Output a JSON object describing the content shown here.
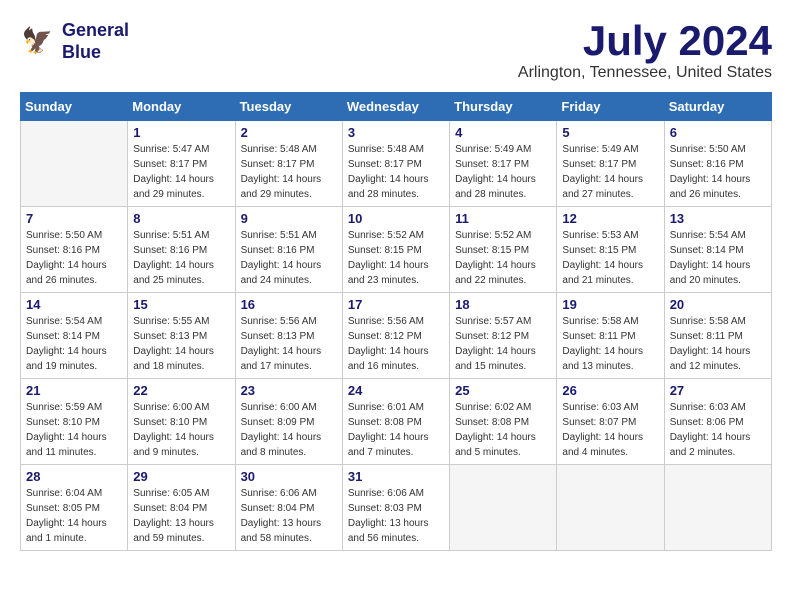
{
  "header": {
    "logo_line1": "General",
    "logo_line2": "Blue",
    "month": "July 2024",
    "location": "Arlington, Tennessee, United States"
  },
  "days_of_week": [
    "Sunday",
    "Monday",
    "Tuesday",
    "Wednesday",
    "Thursday",
    "Friday",
    "Saturday"
  ],
  "weeks": [
    [
      {
        "day": "",
        "info": ""
      },
      {
        "day": "1",
        "info": "Sunrise: 5:47 AM\nSunset: 8:17 PM\nDaylight: 14 hours\nand 29 minutes."
      },
      {
        "day": "2",
        "info": "Sunrise: 5:48 AM\nSunset: 8:17 PM\nDaylight: 14 hours\nand 29 minutes."
      },
      {
        "day": "3",
        "info": "Sunrise: 5:48 AM\nSunset: 8:17 PM\nDaylight: 14 hours\nand 28 minutes."
      },
      {
        "day": "4",
        "info": "Sunrise: 5:49 AM\nSunset: 8:17 PM\nDaylight: 14 hours\nand 28 minutes."
      },
      {
        "day": "5",
        "info": "Sunrise: 5:49 AM\nSunset: 8:17 PM\nDaylight: 14 hours\nand 27 minutes."
      },
      {
        "day": "6",
        "info": "Sunrise: 5:50 AM\nSunset: 8:16 PM\nDaylight: 14 hours\nand 26 minutes."
      }
    ],
    [
      {
        "day": "7",
        "info": "Sunrise: 5:50 AM\nSunset: 8:16 PM\nDaylight: 14 hours\nand 26 minutes."
      },
      {
        "day": "8",
        "info": "Sunrise: 5:51 AM\nSunset: 8:16 PM\nDaylight: 14 hours\nand 25 minutes."
      },
      {
        "day": "9",
        "info": "Sunrise: 5:51 AM\nSunset: 8:16 PM\nDaylight: 14 hours\nand 24 minutes."
      },
      {
        "day": "10",
        "info": "Sunrise: 5:52 AM\nSunset: 8:15 PM\nDaylight: 14 hours\nand 23 minutes."
      },
      {
        "day": "11",
        "info": "Sunrise: 5:52 AM\nSunset: 8:15 PM\nDaylight: 14 hours\nand 22 minutes."
      },
      {
        "day": "12",
        "info": "Sunrise: 5:53 AM\nSunset: 8:15 PM\nDaylight: 14 hours\nand 21 minutes."
      },
      {
        "day": "13",
        "info": "Sunrise: 5:54 AM\nSunset: 8:14 PM\nDaylight: 14 hours\nand 20 minutes."
      }
    ],
    [
      {
        "day": "14",
        "info": "Sunrise: 5:54 AM\nSunset: 8:14 PM\nDaylight: 14 hours\nand 19 minutes."
      },
      {
        "day": "15",
        "info": "Sunrise: 5:55 AM\nSunset: 8:13 PM\nDaylight: 14 hours\nand 18 minutes."
      },
      {
        "day": "16",
        "info": "Sunrise: 5:56 AM\nSunset: 8:13 PM\nDaylight: 14 hours\nand 17 minutes."
      },
      {
        "day": "17",
        "info": "Sunrise: 5:56 AM\nSunset: 8:12 PM\nDaylight: 14 hours\nand 16 minutes."
      },
      {
        "day": "18",
        "info": "Sunrise: 5:57 AM\nSunset: 8:12 PM\nDaylight: 14 hours\nand 15 minutes."
      },
      {
        "day": "19",
        "info": "Sunrise: 5:58 AM\nSunset: 8:11 PM\nDaylight: 14 hours\nand 13 minutes."
      },
      {
        "day": "20",
        "info": "Sunrise: 5:58 AM\nSunset: 8:11 PM\nDaylight: 14 hours\nand 12 minutes."
      }
    ],
    [
      {
        "day": "21",
        "info": "Sunrise: 5:59 AM\nSunset: 8:10 PM\nDaylight: 14 hours\nand 11 minutes."
      },
      {
        "day": "22",
        "info": "Sunrise: 6:00 AM\nSunset: 8:10 PM\nDaylight: 14 hours\nand 9 minutes."
      },
      {
        "day": "23",
        "info": "Sunrise: 6:00 AM\nSunset: 8:09 PM\nDaylight: 14 hours\nand 8 minutes."
      },
      {
        "day": "24",
        "info": "Sunrise: 6:01 AM\nSunset: 8:08 PM\nDaylight: 14 hours\nand 7 minutes."
      },
      {
        "day": "25",
        "info": "Sunrise: 6:02 AM\nSunset: 8:08 PM\nDaylight: 14 hours\nand 5 minutes."
      },
      {
        "day": "26",
        "info": "Sunrise: 6:03 AM\nSunset: 8:07 PM\nDaylight: 14 hours\nand 4 minutes."
      },
      {
        "day": "27",
        "info": "Sunrise: 6:03 AM\nSunset: 8:06 PM\nDaylight: 14 hours\nand 2 minutes."
      }
    ],
    [
      {
        "day": "28",
        "info": "Sunrise: 6:04 AM\nSunset: 8:05 PM\nDaylight: 14 hours\nand 1 minute."
      },
      {
        "day": "29",
        "info": "Sunrise: 6:05 AM\nSunset: 8:04 PM\nDaylight: 13 hours\nand 59 minutes."
      },
      {
        "day": "30",
        "info": "Sunrise: 6:06 AM\nSunset: 8:04 PM\nDaylight: 13 hours\nand 58 minutes."
      },
      {
        "day": "31",
        "info": "Sunrise: 6:06 AM\nSunset: 8:03 PM\nDaylight: 13 hours\nand 56 minutes."
      },
      {
        "day": "",
        "info": ""
      },
      {
        "day": "",
        "info": ""
      },
      {
        "day": "",
        "info": ""
      }
    ]
  ]
}
